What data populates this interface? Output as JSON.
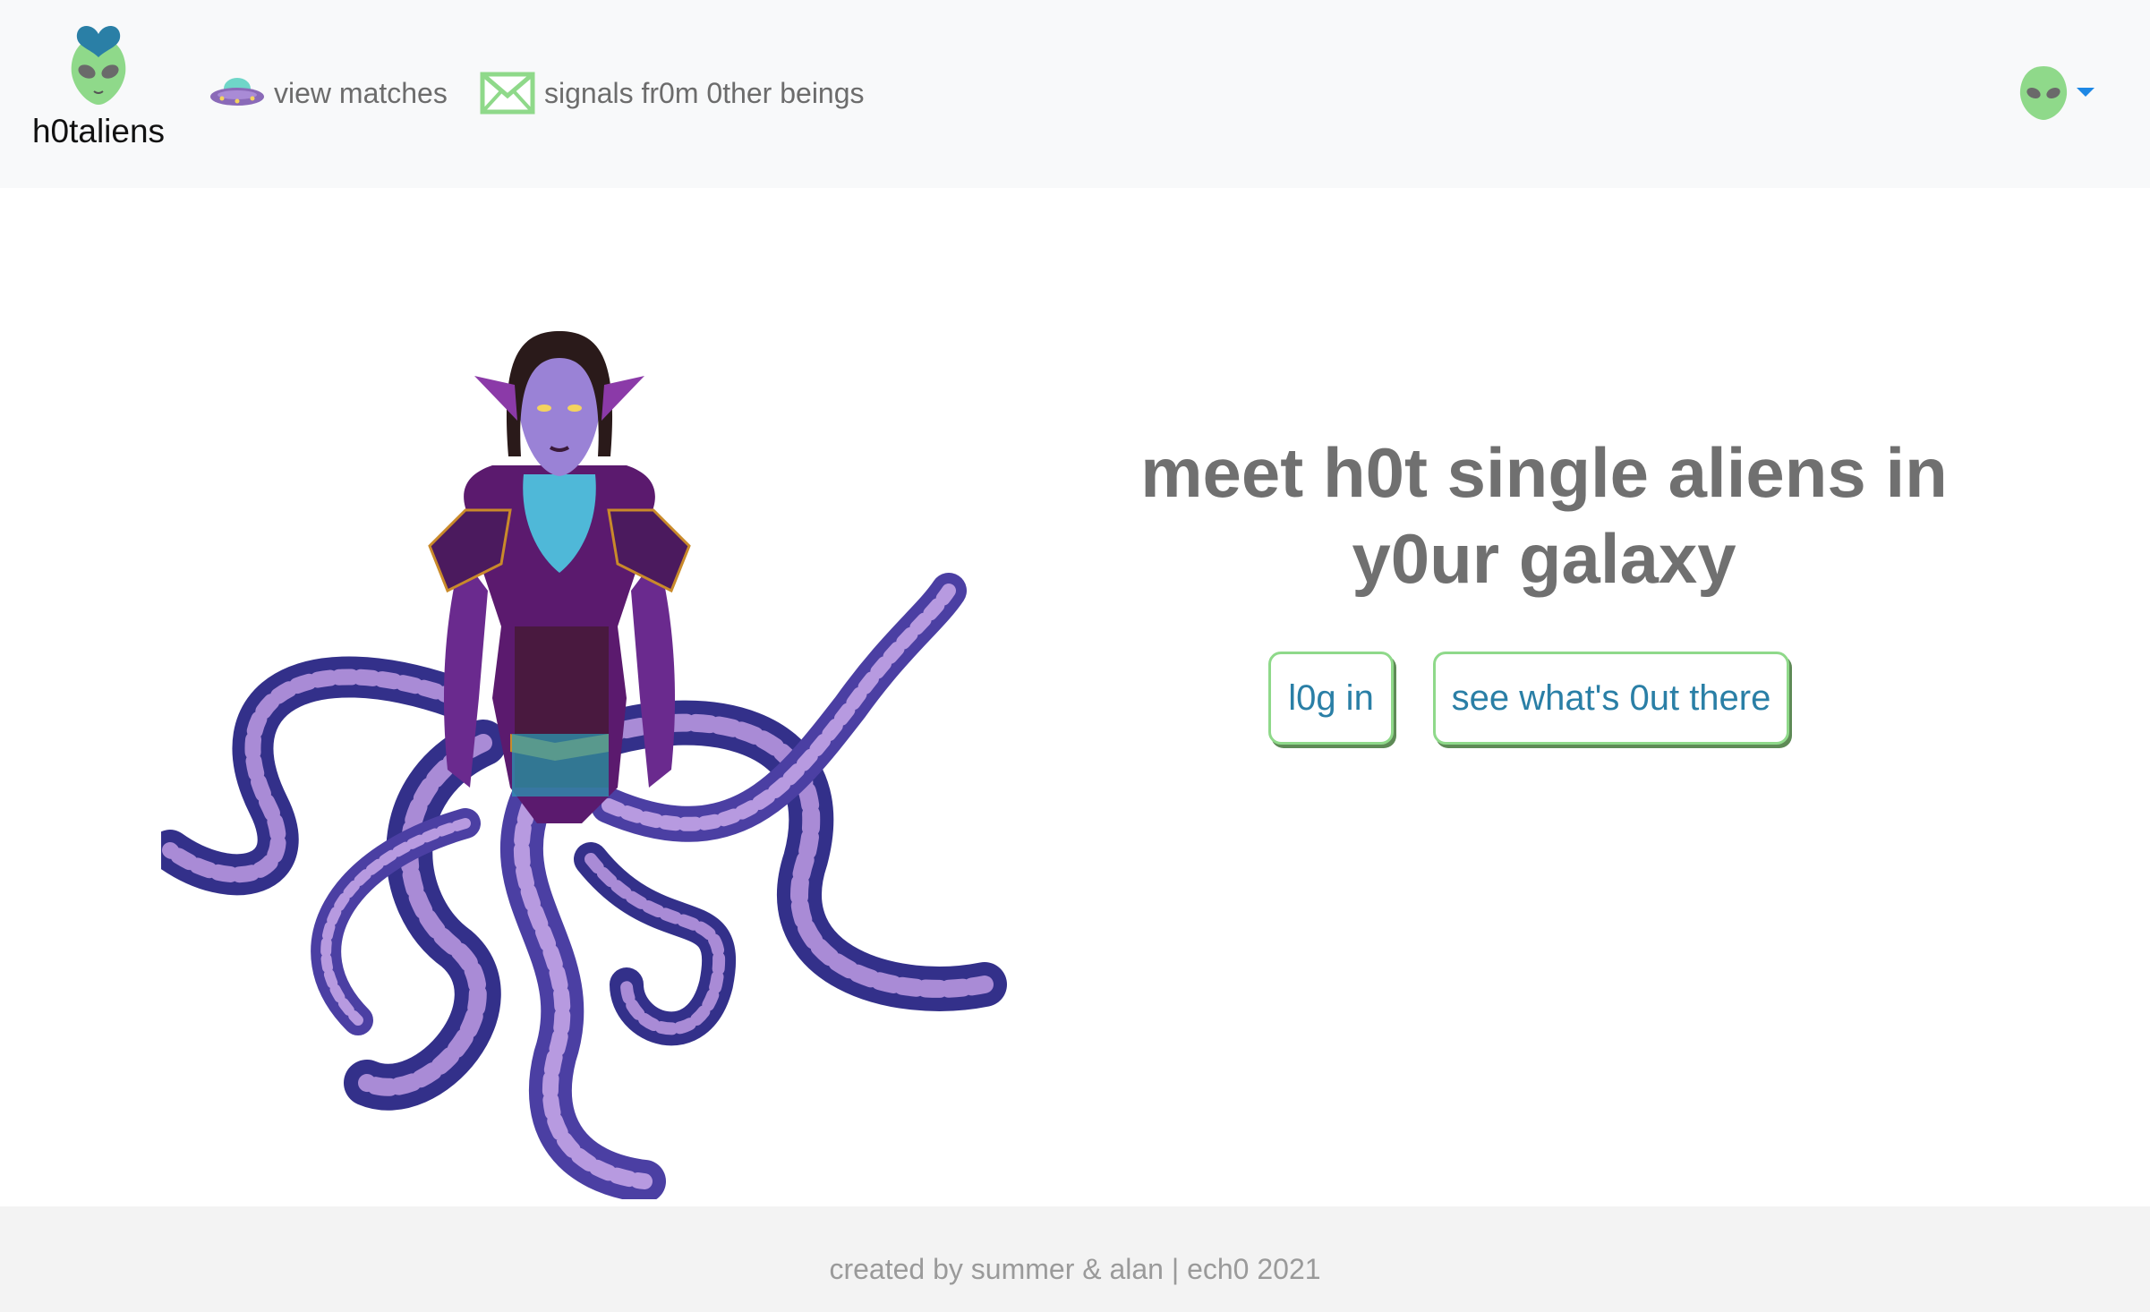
{
  "app": {
    "brand_name": "h0taliens",
    "brand_icon": "alien-heart-icon"
  },
  "nav": {
    "links": [
      {
        "label": "view matches",
        "icon": "ufo-icon"
      },
      {
        "label": "signals fr0m 0ther beings",
        "icon": "envelope-icon"
      }
    ],
    "user_icon": "alien-avatar-icon"
  },
  "hero": {
    "headline": "meet h0t single aliens in y0ur galaxy",
    "login_label": "l0g in",
    "explore_label": "see what's 0ut there",
    "illustration": "tentacled-alien-woman-illustration"
  },
  "footer": {
    "text": "created by summer & alan | ech0 2021"
  },
  "colors": {
    "navbar_bg": "#f8f9fa",
    "footer_bg": "#f3f3f3",
    "alien_green": "#8fd98a",
    "button_text": "#2a7fa6",
    "headline_gray": "#707070",
    "tentacle_purple": "#4b3fa3"
  }
}
